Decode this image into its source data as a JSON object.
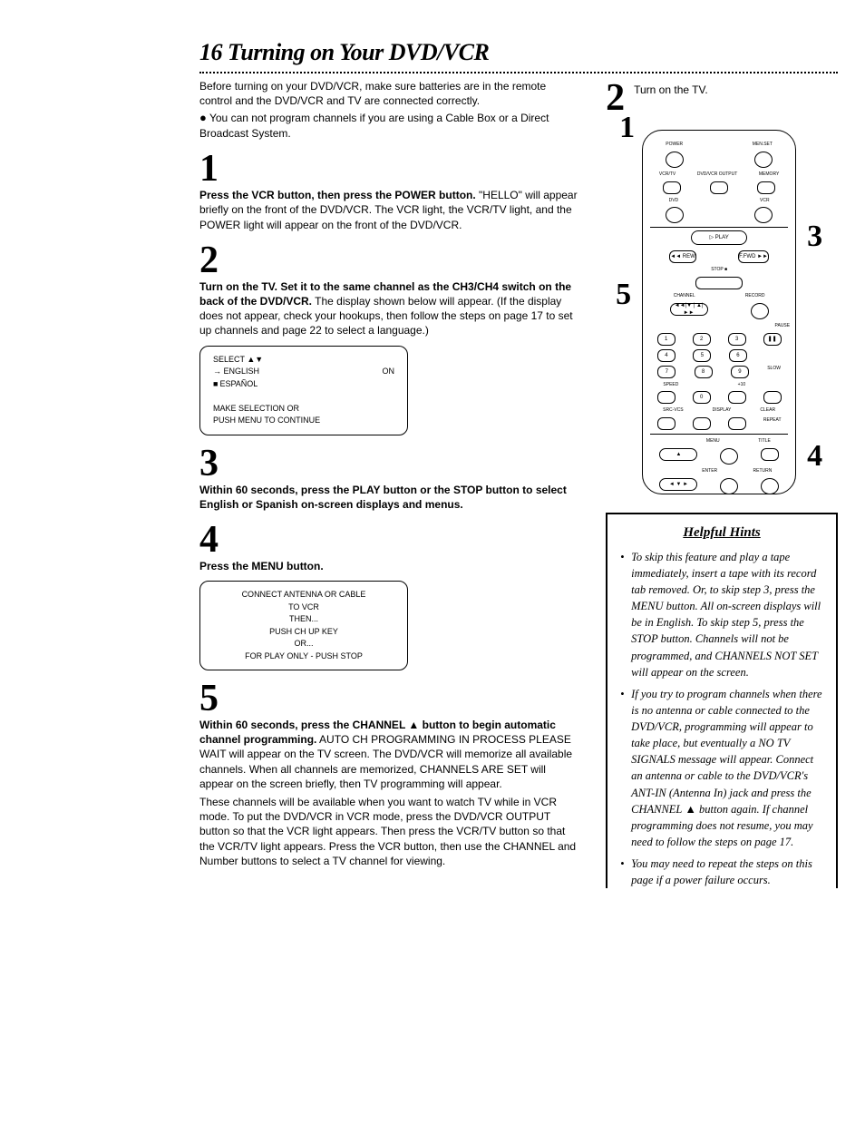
{
  "title": "16 Turning on Your DVD/VCR",
  "intro": "Before turning on your DVD/VCR, make sure batteries are in the remote control and the DVD/VCR and TV are connected correctly.",
  "intro_bullet": "You can not program channels if you are using a Cable Box or a Direct Broadcast System.",
  "steps": {
    "s1": {
      "num": "1",
      "bold": "Press the VCR button, then press the POWER button.",
      "body": "\"HELLO\" will appear briefly on the front of the DVD/VCR. The VCR light, the VCR/TV light, and the POWER light will appear on the front of the DVD/VCR."
    },
    "s2": {
      "num": "2",
      "bold": "Turn on the TV. Set it to the same channel as the CH3/CH4 switch on the back of the DVD/VCR.",
      "body": " The display shown below will appear. (If the display does not appear, check your hookups, then follow the steps on page 17 to set up channels and page 22 to select a language.)"
    },
    "s3": {
      "num": "3",
      "bold": "Within 60 seconds, press the PLAY button or the STOP button to select English or Spanish on-screen displays and menus."
    },
    "s4": {
      "num": "4",
      "bold": "Press the MENU button."
    },
    "s5": {
      "num": "5",
      "bold_a": "Within 60 seconds, press the CHANNEL ",
      "bold_b": " button to begin automatic channel programming.",
      "body1": " AUTO CH PROGRAMMING IN PROCESS PLEASE WAIT will appear on the TV screen. The DVD/VCR will memorize all available channels. When all channels are memorized, CHANNELS ARE SET will appear on the screen briefly, then TV programming will appear.",
      "body2": "These channels will be available when you want to watch TV while in VCR mode. To put the DVD/VCR in VCR mode, press the DVD/VCR OUTPUT button so that the VCR light appears. Then press the VCR/TV button so that the VCR/TV light appears. Press the VCR button, then use the CHANNEL and Number buttons to select a TV channel for viewing."
    }
  },
  "screen1": {
    "select": "SELECT",
    "english": "ENGLISH",
    "espanol": "ESPAÑOL",
    "on": "ON",
    "make": "MAKE SELECTION OR",
    "push": "PUSH MENU TO CONTINUE"
  },
  "screen2": {
    "l1": "CONNECT ANTENNA OR CABLE",
    "l2": "TO VCR",
    "l3": "THEN...",
    "l4": "PUSH CH UP KEY",
    "l5": "OR...",
    "l6": "FOR PLAY ONLY - PUSH STOP"
  },
  "right": {
    "step2num": "2",
    "step2txt": "Turn on the TV.",
    "mark1": "1",
    "mark3": "3",
    "mark4": "4",
    "mark5": "5"
  },
  "remote": {
    "power": "POWER",
    "menset": "MEN.SET",
    "dvdvcr": "DVD/VCR OUTPUT",
    "vcrtv": "VCR/TV",
    "memory": "MEMORY",
    "dvd": "DVD",
    "vcr": "VCR",
    "play": "▷ PLAY",
    "rew": "◄◄ REW",
    "ffwd": "F.FWD ►►",
    "stop": "STOP ■",
    "channel": "CHANNEL",
    "record": "RECORD",
    "pause": "PAUSE",
    "slow": "SLOW",
    "speed": "SPEED",
    "p10": "+10",
    "srcvcs": "SRC-VCS",
    "disp": "DISPLAY",
    "clear": "CLEAR",
    "repeat": "REPEAT",
    "menu": "MENU",
    "title": "TITLE",
    "enter": "ENTER",
    "return": "RETURN"
  },
  "hints": {
    "title": "Helpful Hints",
    "h1": "To skip this feature and play a tape immediately, insert a tape with its record tab removed. Or, to skip step 3, press the MENU button. All on-screen displays will be in English. To skip step 5, press the STOP button. Channels will not be programmed, and CHANNELS NOT SET will appear on the screen.",
    "h2a": "If you try to program channels when there is no antenna or cable connected to the DVD/VCR, programming will appear to take place, but eventually a NO TV SIGNALS message will appear. Connect an antenna or cable to the DVD/VCR's ANT-IN (Antenna In) jack and press the CHANNEL",
    "h2b": " button again. If channel programming does not resume, you may need to follow the steps on page 17.",
    "h3": "You may need to repeat the steps on this page if a power failure occurs."
  }
}
